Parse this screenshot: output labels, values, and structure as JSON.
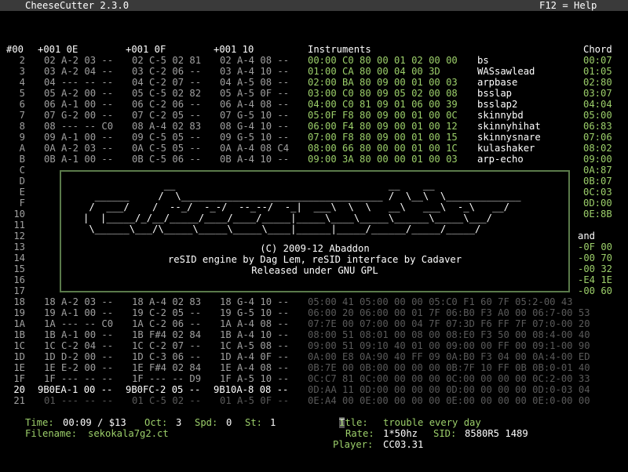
{
  "app": {
    "title": "CheeseCutter 2.3.0",
    "help": "F12 = Help"
  },
  "headers": {
    "row_marker": "#00",
    "track1": "+001 0E",
    "track2": "+001 0F",
    "track3": "+001 10",
    "instruments": "Instruments",
    "chord": "Chord"
  },
  "tracker_rows": [
    {
      "n": "2",
      "a": "02 A-2 03 --",
      "b": "02 C-5 02 81",
      "c": "02 A-4 08 --",
      "instr": "00:00 C0 80 00 01 02 00 00",
      "name": "bs",
      "chord": "00:07"
    },
    {
      "n": "3",
      "a": "03 A-2 04 --",
      "b": "03 C-2 06 --",
      "c": "03 A-4 10 --",
      "instr": "01:00 CA 80 00 04 00 3D",
      "name": "WASsawlead",
      "chord": "01:05"
    },
    {
      "n": "4",
      "a": "04 --- -- --",
      "b": "04 C-2 07 --",
      "c": "04 A-5 08 --",
      "instr": "02:00 BA 80 09 00 01 00 03",
      "name": "arpbase",
      "chord": "02:80"
    },
    {
      "n": "5",
      "a": "05 A-2 00 --",
      "b": "05 C-5 02 82",
      "c": "05 A-5 0F --",
      "instr": "03:00 C0 80 09 05 02 00 08",
      "name": "bsslap",
      "chord": "03:07"
    },
    {
      "n": "6",
      "a": "06 A-1 00 --",
      "b": "06 C-2 06 --",
      "c": "06 A-4 08 --",
      "instr": "04:00 C0 81 09 01 06 00 39",
      "name": "bsslap2",
      "chord": "04:04"
    },
    {
      "n": "7",
      "a": "07 G-2 00 --",
      "b": "07 C-2 05 --",
      "c": "07 G-5 10 --",
      "instr": "05:0F F8 80 09 00 01 00 0C",
      "name": "skinnybd",
      "chord": "05:00"
    },
    {
      "n": "8",
      "a": "08 --- -- C0",
      "b": "08 A-4 02 83",
      "c": "08 G-4 10 --",
      "instr": "06:00 F4 80 09 00 01 00 12",
      "name": "skinnyhihat",
      "chord": "06:83"
    },
    {
      "n": "9",
      "a": "09 A-1 00 --",
      "b": "09 C-5 05 --",
      "c": "09 G-5 10 --",
      "instr": "07:00 F8 80 09 00 01 00 15",
      "name": "skinnysnare",
      "chord": "07:06"
    },
    {
      "n": "A",
      "a": "0A A-2 03 --",
      "b": "0A C-5 05 --",
      "c": "0A A-4 08 C4",
      "instr": "08:00 66 80 00 00 01 00 1C",
      "name": "kulashaker",
      "chord": "08:02"
    },
    {
      "n": "B",
      "a": "0B A-1 00 --",
      "b": "0B C-5 06 --",
      "c": "0B A-4 10 --",
      "instr": "09:00 3A 80 00 00 01 00 03",
      "name": "arp-echo",
      "chord": "09:00"
    }
  ],
  "under_rows": [
    {
      "n": "C",
      "chord": "0A:87"
    },
    {
      "n": "D",
      "chord": "0B:07"
    },
    {
      "n": "E",
      "chord": "0C:03"
    },
    {
      "n": "F",
      "chord": "0D:00"
    },
    {
      "n": "10",
      "chord": "0E:8B"
    },
    {
      "n": "11",
      "chord": ""
    },
    {
      "n": "12",
      "chord": "and"
    },
    {
      "n": "13",
      "chord": "-0F 00"
    },
    {
      "n": "14",
      "chord": "-00 70"
    },
    {
      "n": "15",
      "chord": "-00 32"
    },
    {
      "n": "16",
      "chord": "-E4 1E"
    },
    {
      "n": "17",
      "chord": "-00 60"
    }
  ],
  "lower_rows": [
    {
      "n": "18",
      "a": "18 A-2 03 --",
      "b": "18 A-4 02 83",
      "c": "18 G-4 10 --",
      "wave": "05:00 41 05:00 00 00 05:C0 F1 60 7F 05:2-00 43"
    },
    {
      "n": "19",
      "a": "19 A-1 00 --",
      "b": "19 C-2 05 --",
      "c": "19 G-5 10 --",
      "wave": "06:00 20 06:00 00 01 7F 06:B0 F3 A0 00 06:7-00 53"
    },
    {
      "n": "1A",
      "a": "1A --- -- C0",
      "b": "1A C-2 06 --",
      "c": "1A A-4 08 --",
      "wave": "07:7E 00 07:00 00 04 7F 07:3D F6 FF 7F 07:0-00 20"
    },
    {
      "n": "1B",
      "a": "1B A-1 00 --",
      "b": "1B F#4 02 84",
      "c": "1B A-4 10 --",
      "wave": "08:00 51 08:01 00 08 00 08:E0 F3 50 00 08:4-00 40"
    },
    {
      "n": "1C",
      "a": "1C C-2 04 --",
      "b": "1C C-2 07 --",
      "c": "1C A-5 08 --",
      "wave": "09:00 51 09:10 40 01 00 09:00 00 FF 00 09:1-00 90"
    },
    {
      "n": "1D",
      "a": "1D D-2 00 --",
      "b": "1D C-3 06 --",
      "c": "1D A-4 0F --",
      "wave": "0A:00 E8 0A:90 40 FF 09 0A:B0 F3 04 00 0A:4-00 ED"
    },
    {
      "n": "1E",
      "a": "1E E-2 00 --",
      "b": "1E F#4 02 84",
      "c": "1E A-4 08 --",
      "wave": "0B:7E 00 0B:00 00 00 00 0B:7F 10 FF 0B 0B:0-01 40"
    },
    {
      "n": "1F",
      "a": "1F --- -- --",
      "b": "1F --- -- D9",
      "c": "1F A-5 10 --",
      "wave": "0C:C7 81 0C:00 00 00 00 0C:00 00 00 00 0C:2-00 33"
    },
    {
      "n": "20",
      "a": "9B0EA-1 00 --",
      "b": "9B0FC-2 05 --",
      "c": "9B10A-8 08 --",
      "wave": "0D:AA 11 0D:00 00 00 00 0D:00 00 00 00 0D:0-03 04"
    },
    {
      "n": "21",
      "a": "01 --- -- --",
      "b": "01 C-5 02 --",
      "c": "01 A-5 0F --",
      "wave": "0E:A4 00 0E:00 00 00 00 0E:00 00 00 00 0E:0-00 00"
    }
  ],
  "about": {
    "logo": [
      "              __                                     __    __",
      "  ______     /  \\___________________________________ /  \\__\\  \\_____________",
      " /  ___/    /  --_/  -_-/  --_--/  -_|  ___\\  \\  \\   __\\   ___\\  -_\\   __/",
      "|  |_____/_/__/_____/____/____/_____|_____\\____\\_____\\______\\_____\\___/",
      " \\______\\___/\\_____\\_____\\_____\\____|______|_____/______/_____/_____/"
    ],
    "copyright": "(C) 2009-12 Abaddon",
    "engine": "reSID engine by Dag Lem, reSID interface by Cadaver",
    "license": "Released under GNU GPL"
  },
  "status": {
    "time_label": "Time:",
    "time_value": "00:09 / $13",
    "oct_label": "Oct:",
    "oct_value": "3",
    "spd_label": "Spd:",
    "spd_value": "0",
    "st_label": "St:",
    "st_value": "1",
    "filename_label": "Filename:",
    "filename_value": "sekokala7g2.ct",
    "title_label": "Title:",
    "title_value": "trouble every day",
    "rate_label": "Rate:",
    "rate_value": "1*50hz",
    "sid_label": "SID:",
    "sid_value": "8580R5 1489",
    "player_label": "Player:",
    "player_value": "CC03.31"
  }
}
